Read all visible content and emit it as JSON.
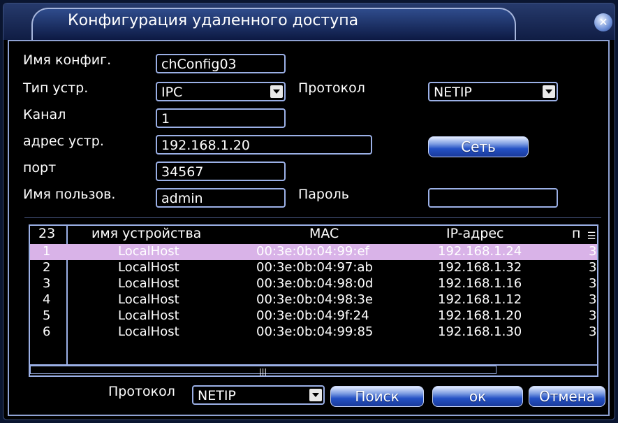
{
  "window": {
    "title": "Конфигурация удаленного доступа",
    "close_icon": "✕"
  },
  "form": {
    "config_name_label": "Имя конфиг.",
    "config_name_value": "chConfig03",
    "device_type_label": "Тип устр.",
    "device_type_value": "IPC",
    "protocol_label": "Протокол",
    "protocol_value": "NETIP",
    "channel_label": "Канал",
    "channel_value": "1",
    "device_address_label": "адрес устр.",
    "device_address_value": "192.168.1.20",
    "network_button": "Сеть",
    "port_label": "порт",
    "port_value": "34567",
    "username_label": "Имя пользов.",
    "username_value": "admin",
    "password_label": "Пароль",
    "password_value": ""
  },
  "device_list": {
    "headers": {
      "index": "23",
      "name": "имя устройства",
      "mac": "MAC",
      "ip": "IP-адрес",
      "extra": "п"
    },
    "selected_index": 0,
    "rows": [
      {
        "index": "1",
        "name": "LocalHost",
        "mac": "00:3e:0b:04:99:ef",
        "ip": "192.168.1.24",
        "extra": "3"
      },
      {
        "index": "2",
        "name": "LocalHost",
        "mac": "00:3e:0b:04:97:ab",
        "ip": "192.168.1.32",
        "extra": "3"
      },
      {
        "index": "3",
        "name": "LocalHost",
        "mac": "00:3e:0b:04:98:0d",
        "ip": "192.168.1.16",
        "extra": "3"
      },
      {
        "index": "4",
        "name": "LocalHost",
        "mac": "00:3e:0b:04:98:3e",
        "ip": "192.168.1.12",
        "extra": "3"
      },
      {
        "index": "5",
        "name": "LocalHost",
        "mac": "00:3e:0b:04:9f:24",
        "ip": "192.168.1.20",
        "extra": "3"
      },
      {
        "index": "6",
        "name": "LocalHost",
        "mac": "00:3e:0b:04:99:85",
        "ip": "192.168.1.30",
        "extra": "3"
      }
    ]
  },
  "footer": {
    "protocol_label": "Протокол",
    "protocol_value": "NETIP",
    "search_button": "Поиск",
    "ok_button": "ок",
    "cancel_button": "Отмена"
  },
  "colors": {
    "accent": "#2451c4",
    "selected_row": "#d9b3e8",
    "border": "#9bb0e6"
  }
}
